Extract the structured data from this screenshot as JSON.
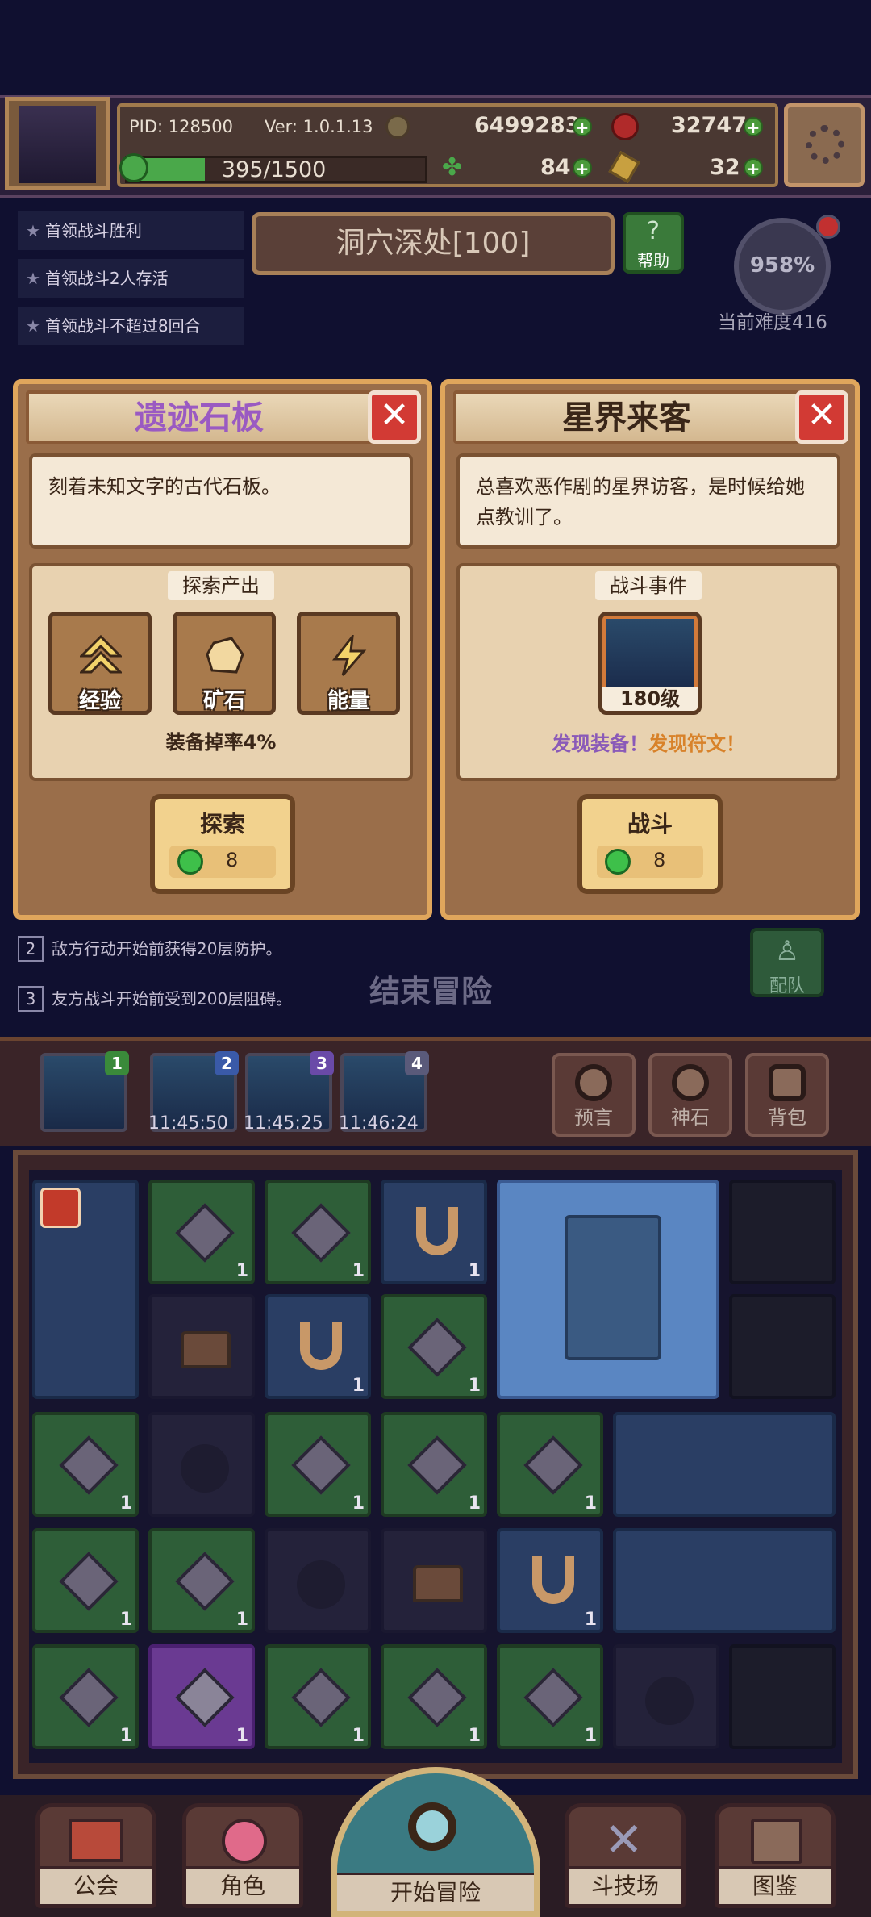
{
  "player": {
    "pid": "PID: 128500",
    "version": "Ver: 1.0.1.13",
    "coins": "6499283",
    "gems_red": "32747",
    "stamina_text": "395/1500",
    "stamina_fraction": 0.26,
    "clover": "84",
    "keys": "32"
  },
  "quests": [
    "首领战斗胜利",
    "首领战斗2人存活",
    "首领战斗不超过8回合"
  ],
  "stage": {
    "name": "洞穴深处[100]",
    "help_label": "帮助",
    "difficulty_pct": "958%",
    "difficulty_label": "当前难度416"
  },
  "cards": [
    {
      "title": "遗迹石板",
      "desc": "刻着未知文字的古代石板。",
      "panel_title": "探索产出",
      "rewards": [
        "经验",
        "矿石",
        "能量"
      ],
      "note": "装备掉率4%",
      "button_label": "探索",
      "cost": "8"
    },
    {
      "title": "星界来客",
      "desc": "总喜欢恶作剧的星界访客，是时候给她点教训了。",
      "panel_title": "战斗事件",
      "level": "180级",
      "discover_a": "发现装备！",
      "discover_b": "发现符文！",
      "button_label": "战斗",
      "cost": "8"
    }
  ],
  "rules": [
    {
      "num": "2",
      "text": "敌方行动开始前获得20层防护。"
    },
    {
      "num": "3",
      "text": "友方战斗开始前受到200层阻碍。"
    }
  ],
  "end_adventure": "结束冒险",
  "team_label": "配队",
  "slots": [
    {
      "num": "1",
      "time": ""
    },
    {
      "num": "2",
      "time": "11:45:50"
    },
    {
      "num": "3",
      "time": "11:45:25"
    },
    {
      "num": "4",
      "time": "11:46:24"
    }
  ],
  "side_buttons": [
    "预言",
    "神石",
    "背包"
  ],
  "grid_count": "1",
  "nav": [
    "公会",
    "角色",
    "开始冒险",
    "斗技场",
    "图鉴"
  ],
  "colors": {
    "accent_gold": "#e0a65c",
    "close_red": "#d23a34",
    "discover_purple": "#8a5ab8",
    "discover_orange": "#d8822a"
  }
}
